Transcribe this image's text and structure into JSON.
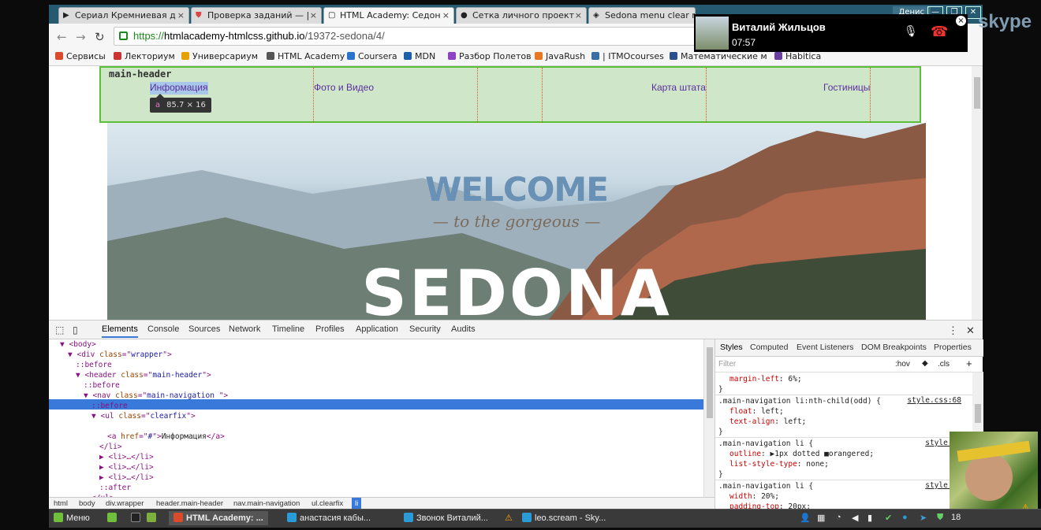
{
  "browser": {
    "tabs": [
      {
        "title": "Сериал Кремниевая д",
        "icon": "play-icon",
        "active": false
      },
      {
        "title": "Проверка заданий — |",
        "icon": "shield-icon",
        "active": false
      },
      {
        "title": "HTML Academy: Седон",
        "icon": "page-icon",
        "active": true
      },
      {
        "title": "Сетка личного проект",
        "icon": "github-icon",
        "active": false
      },
      {
        "title": "Sedona menu clear ma",
        "icon": "codepen-icon",
        "active": false
      }
    ],
    "user_badge": "Денис",
    "url": {
      "scheme": "https://",
      "host": "htmlacademy-htmlcss.github.io",
      "path": "/19372-sedona/4/"
    },
    "bookmarks": [
      {
        "label": "Сервисы",
        "color": "#d94b2b"
      },
      {
        "label": "Лекториум",
        "color": "#c33"
      },
      {
        "label": "Универсариум",
        "color": "#e6a100"
      },
      {
        "label": "HTML Academy",
        "color": "#555"
      },
      {
        "label": "Coursera",
        "color": "#2a73cc"
      },
      {
        "label": "MDN",
        "color": "#1d5fa8"
      },
      {
        "label": "Разбор Полетов",
        "color": "#8c44c0"
      },
      {
        "label": "JavaRush",
        "color": "#e87722"
      },
      {
        "label": "| ITMOcourses",
        "color": "#3a6ea5"
      },
      {
        "label": "Математические м",
        "color": "#2b4e8c"
      },
      {
        "label": "Habitica",
        "color": "#6b3fa0"
      }
    ]
  },
  "page": {
    "header_label": "main-header",
    "nav": [
      "Информация",
      "Фото и Видео",
      "Карта штата",
      "Гостиницы"
    ],
    "tooltip": {
      "tag": "a",
      "size": "85.7 × 16"
    },
    "hero": {
      "welcome": "WELCOME",
      "subtitle": "— to the gorgeous —",
      "title": "SEDONA"
    }
  },
  "devtools": {
    "tabs": [
      "Elements",
      "Console",
      "Sources",
      "Network",
      "Timeline",
      "Profiles",
      "Application",
      "Security",
      "Audits"
    ],
    "active_tab": "Elements",
    "dom_lines": [
      {
        "indent": 2,
        "arrow": "▼",
        "html": "<body>"
      },
      {
        "indent": 3,
        "arrow": "▼",
        "tag": "div",
        "attr": "class",
        "val": "wrapper"
      },
      {
        "indent": 4,
        "arrow": "",
        "pseudo": "::before"
      },
      {
        "indent": 4,
        "arrow": "▼",
        "tag": "header",
        "attr": "class",
        "val": "main-header"
      },
      {
        "indent": 5,
        "arrow": "",
        "pseudo": "::before"
      },
      {
        "indent": 5,
        "arrow": "▼",
        "tag": "nav",
        "attr": "class",
        "val": "main-navigation "
      },
      {
        "indent": 6,
        "arrow": "",
        "pseudo": "::before"
      },
      {
        "indent": 6,
        "arrow": "▼",
        "tag": "ul",
        "attr": "class",
        "val": "clearfix"
      },
      {
        "indent": 7,
        "arrow": "▼",
        "selected": "<li> == $0"
      },
      {
        "indent": 8,
        "arrow": "",
        "anchor": {
          "attr": "href",
          "val": "#",
          "text": "Информация"
        }
      },
      {
        "indent": 7,
        "arrow": "",
        "close": "</li>"
      },
      {
        "indent": 7,
        "arrow": "▶",
        "collapsed": "<li>…</li>"
      },
      {
        "indent": 7,
        "arrow": "▶",
        "collapsed": "<li>…</li>"
      },
      {
        "indent": 7,
        "arrow": "▶",
        "collapsed": "<li>…</li>"
      },
      {
        "indent": 7,
        "arrow": "",
        "pseudo": "::after"
      },
      {
        "indent": 6,
        "arrow": "",
        "close": "</ul>"
      }
    ],
    "breadcrumbs": [
      "html",
      "body",
      "div.wrapper",
      "header.main-header",
      "nav.main-navigation",
      "ul.clearfix",
      "li"
    ],
    "styles_tabs": [
      "Styles",
      "Computed",
      "Event Listeners",
      "DOM Breakpoints",
      "Properties"
    ],
    "filter_placeholder": "Filter",
    "filter_hov": ":hov",
    "filter_cls": ".cls",
    "rules": [
      {
        "selector": "",
        "source": "",
        "props": [
          [
            "margin-left",
            "6%;"
          ]
        ]
      },
      {
        "selector": ".main-navigation li:nth-child(odd) {",
        "source": "style.css:68",
        "props": [
          [
            "float",
            "left;"
          ],
          [
            "text-align",
            "left;"
          ]
        ]
      },
      {
        "selector": ".main-navigation li {",
        "source": "style.cs",
        "props": [
          [
            "outline",
            "▶1px dotted ■orangered;"
          ],
          [
            "list-style-type",
            "none;"
          ]
        ]
      },
      {
        "selector": ".main-navigation li {",
        "source": "style.cs",
        "props": [
          [
            "width",
            "20%;"
          ],
          [
            "padding-top",
            "20px;"
          ]
        ]
      }
    ]
  },
  "skype": {
    "caller": "Виталий Жильцов",
    "duration": "07:57",
    "logo": "skype"
  },
  "taskbar": {
    "menu": "Меню",
    "items": [
      {
        "label": "HTML Academy: ...",
        "color": "#d94b2b"
      },
      {
        "label": "анастасия кабы...",
        "color": "#2a9bd6"
      },
      {
        "label": "Звонок Виталий...",
        "color": "#2a9bd6"
      },
      {
        "label": "leo.scream - Sky...",
        "color": "#2a9bd6"
      }
    ],
    "clock": "18"
  }
}
